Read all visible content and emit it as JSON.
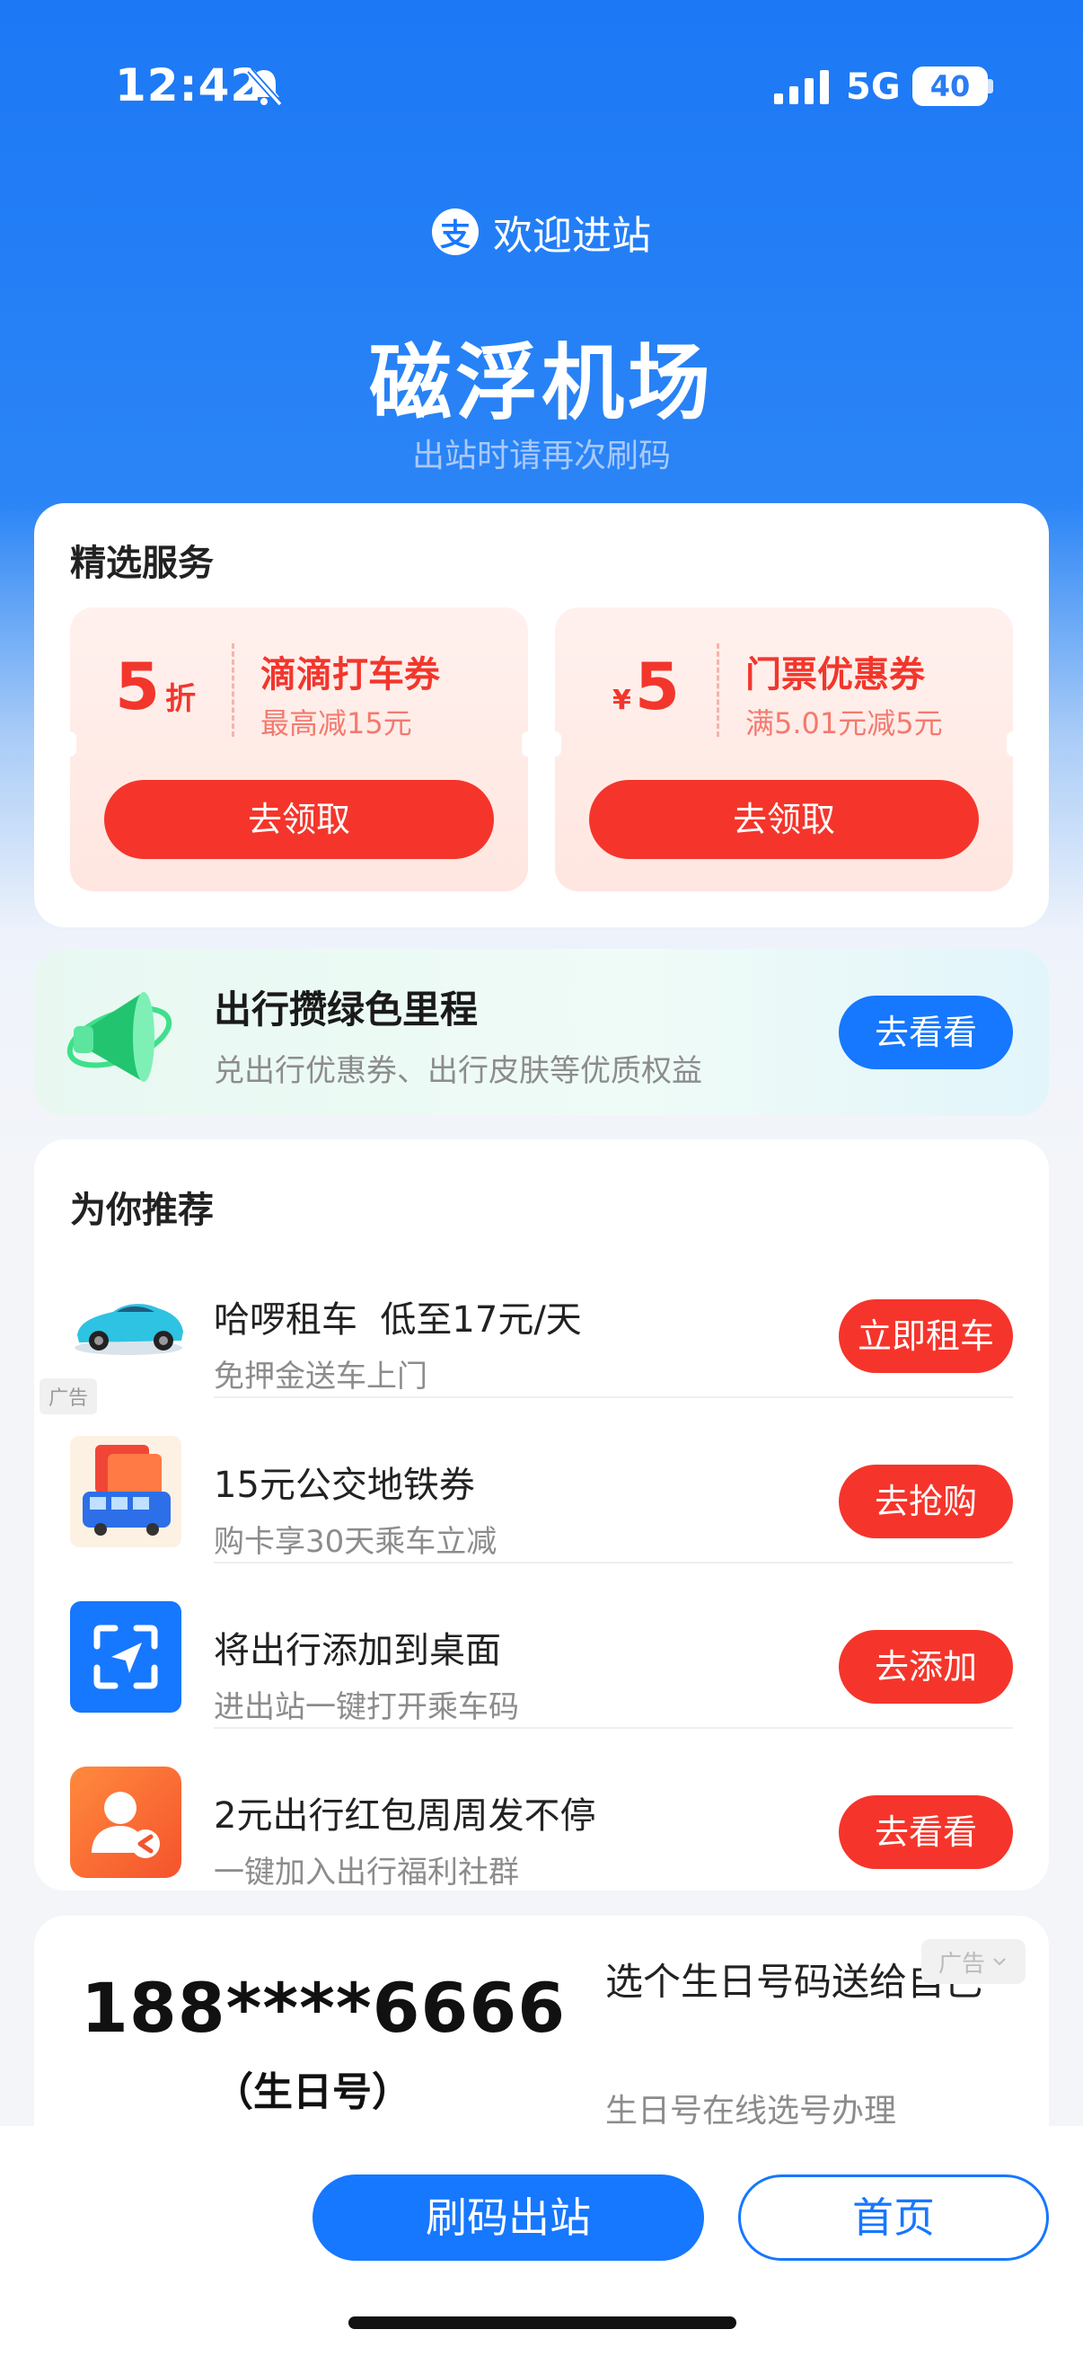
{
  "status_bar": {
    "time": "12:42",
    "network": "5G",
    "battery": "40"
  },
  "header": {
    "welcome": "欢迎进站",
    "logo_char": "支",
    "station": "磁浮机场",
    "hint": "出站时请再次刷码"
  },
  "services": {
    "title": "精选服务",
    "coupons": [
      {
        "value": "5",
        "unit": "折",
        "name": "滴滴打车券",
        "desc": "最高减15元",
        "button": "去领取"
      },
      {
        "currency": "¥",
        "value": "5",
        "name": "门票优惠券",
        "desc": "满5.01元减5元",
        "button": "去领取"
      }
    ]
  },
  "green": {
    "title": "出行攒绿色里程",
    "desc": "兑出行优惠券、出行皮肤等优质权益",
    "button": "去看看"
  },
  "recommend": {
    "title": "为你推荐",
    "ad_tag": "广告",
    "items": [
      {
        "title": "哈啰租车  低至17元/天",
        "desc": "免押金送车上门",
        "button": "立即租车",
        "icon": "car-icon"
      },
      {
        "title": "15元公交地铁券",
        "desc": "购卡享30天乘车立减",
        "button": "去抢购",
        "icon": "bus-coupon-icon"
      },
      {
        "title": "将出行添加到桌面",
        "desc": "进出站一键打开乘车码",
        "button": "去添加",
        "icon": "scan-icon"
      },
      {
        "title": "2元出行红包周周发不停",
        "desc": "一键加入出行福利社群",
        "button": "去看看",
        "icon": "group-icon"
      }
    ]
  },
  "ad_card": {
    "number": "188****6666",
    "number_sub": "（生日号）",
    "title": "选个生日号码送给自己",
    "desc": "生日号在线选号办理",
    "ad_tag": "广告"
  },
  "bottom": {
    "primary": "刷码出站",
    "secondary": "首页"
  },
  "colors": {
    "primary": "#1677ff",
    "red": "#f5352b"
  }
}
